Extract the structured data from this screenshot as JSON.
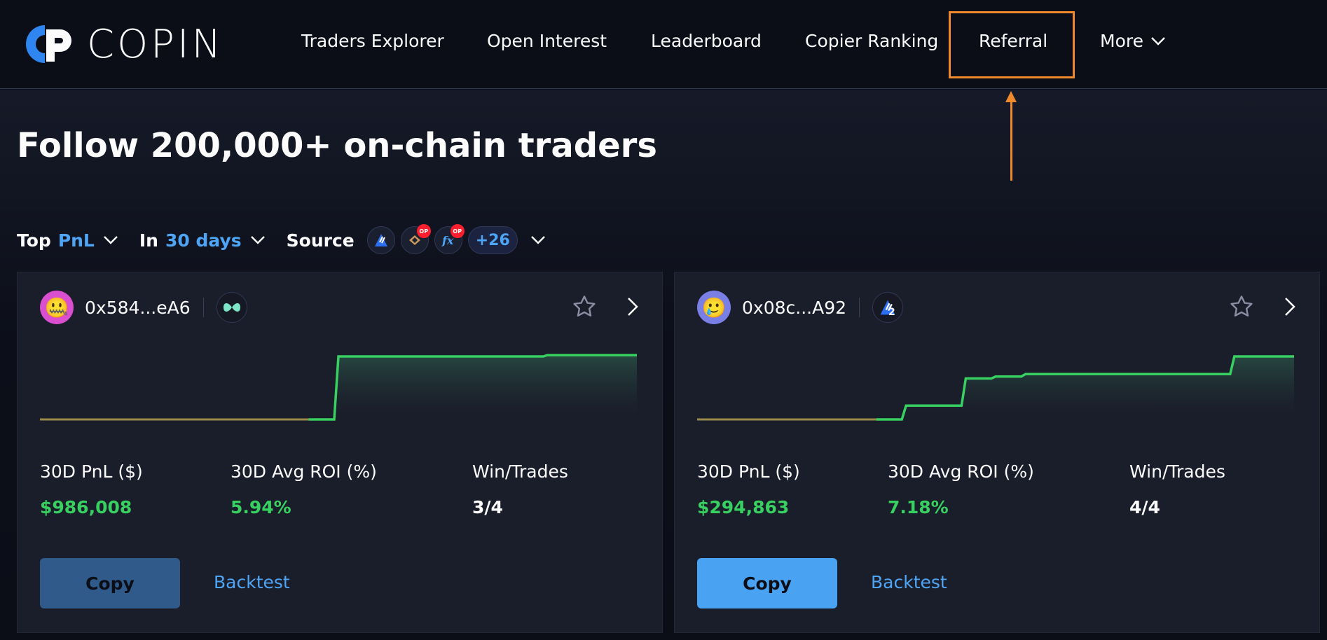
{
  "brand": {
    "name": "COPIN",
    "accent": "#4ea5f5",
    "highlight": "#f0892c",
    "profit": "#38d060"
  },
  "nav": {
    "items": [
      "Traders Explorer",
      "Open Interest",
      "Leaderboard",
      "Copier Ranking",
      "Referral"
    ],
    "more": "More",
    "highlighted": "Referral"
  },
  "hero": {
    "headline": "Follow 200,000+ on-chain traders"
  },
  "filters": {
    "sort_label": "Top",
    "sort_value": "PnL",
    "period_label": "In",
    "period_value": "30 days",
    "source_label": "Source",
    "source_more": "+26",
    "source_icons": [
      "arbitrum-icon",
      "kwenta-op-icon",
      "fx-op-icon"
    ],
    "source_badge": "OP"
  },
  "cards": [
    {
      "avatar": "🤐",
      "avatar_color": "#d94fd0",
      "address": "0x584...eA6",
      "protocol_icon": "hyperliquid-icon",
      "stats": [
        {
          "label": "30D PnL ($)",
          "value": "$986,008",
          "tone": "green"
        },
        {
          "label": "30D Avg ROI (%)",
          "value": "5.94%",
          "tone": "green"
        },
        {
          "label": "Win/Trades",
          "value": "3/4",
          "tone": "white"
        }
      ],
      "copy_label": "Copy",
      "copy_color": "#2f5a8a",
      "backtest_label": "Backtest",
      "pnl_curve": [
        0,
        0,
        0,
        0,
        0,
        0,
        0,
        0,
        0,
        0,
        1,
        1,
        1,
        1,
        1,
        1,
        1,
        1.02,
        1.02,
        1.02,
        1.02
      ]
    },
    {
      "avatar": "🥲",
      "avatar_color": "#7a7fe6",
      "address": "0x08c...A92",
      "protocol_icon": "arbitrum-icon",
      "protocol_badge": "2",
      "stats": [
        {
          "label": "30D PnL ($)",
          "value": "$294,863",
          "tone": "green"
        },
        {
          "label": "30D Avg ROI (%)",
          "value": "7.18%",
          "tone": "green"
        },
        {
          "label": "Win/Trades",
          "value": "4/4",
          "tone": "white"
        }
      ],
      "copy_label": "Copy",
      "copy_color": "#4aa3f2",
      "backtest_label": "Backtest",
      "pnl_curve": [
        0,
        0,
        0,
        0,
        0,
        0,
        0,
        0.22,
        0.22,
        0.65,
        0.68,
        0.72,
        0.72,
        0.72,
        0.72,
        0.72,
        0.72,
        0.72,
        1,
        1,
        1
      ]
    }
  ]
}
